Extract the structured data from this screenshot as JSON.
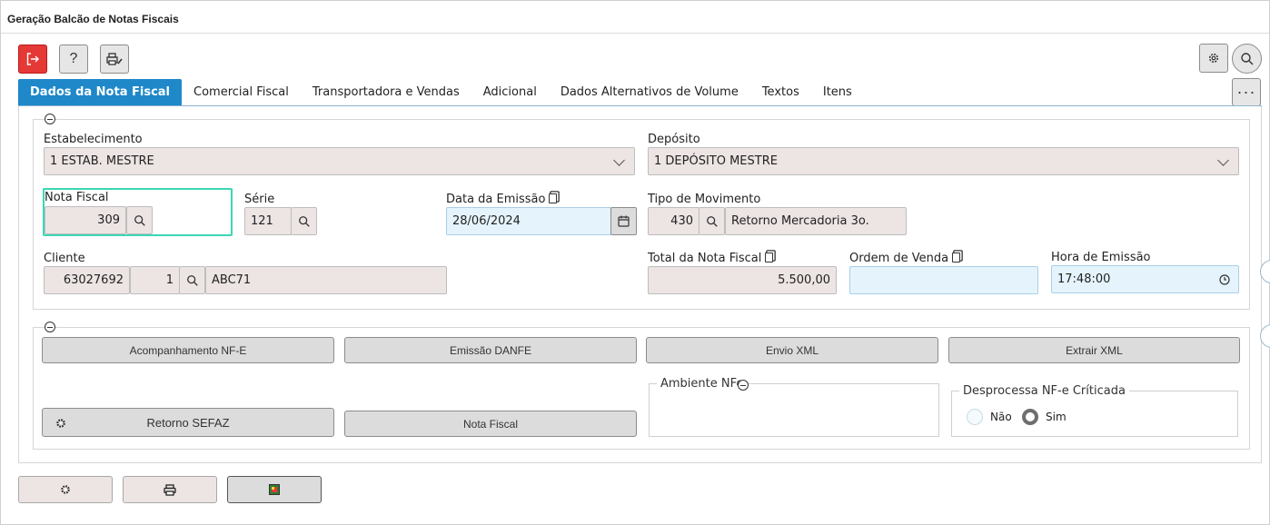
{
  "window": {
    "title": "Geração Balcão de Notas Fiscais"
  },
  "toolbar": {
    "exit_icon": "exit-icon",
    "help_label": "?",
    "print_tools_icon": "printer-wrench-icon",
    "config_icon": "gear-icon",
    "search_icon": "search-icon",
    "more_label": "···"
  },
  "tabs": [
    {
      "label": "Dados da Nota Fiscal"
    },
    {
      "label": "Comercial Fiscal"
    },
    {
      "label": "Transportadora e Vendas"
    },
    {
      "label": "Adicional"
    },
    {
      "label": "Dados Alternativos de Volume"
    },
    {
      "label": "Textos"
    },
    {
      "label": "Itens"
    }
  ],
  "form": {
    "estabelecimento": {
      "label": "Estabelecimento",
      "value": "1 ESTAB. MESTRE"
    },
    "deposito": {
      "label": "Depósito",
      "value": "1 DEPÓSITO MESTRE"
    },
    "nota_fiscal": {
      "label": "Nota Fiscal",
      "value": "309"
    },
    "serie": {
      "label": "Série",
      "value": "121"
    },
    "data_emissao": {
      "label": "Data da Emissão",
      "value": "28/06/2024"
    },
    "tipo_movimento": {
      "label": "Tipo de Movimento",
      "code": "430",
      "description": "Retorno Mercadoria 3o."
    },
    "cliente": {
      "label": "Cliente",
      "code": "63027692",
      "seq": "1",
      "name": "ABC71"
    },
    "total_nf": {
      "label": "Total da Nota Fiscal",
      "value": "5.500,00"
    },
    "ordem_venda": {
      "label": "Ordem de Venda",
      "value": ""
    },
    "hora_emissao": {
      "label": "Hora de Emissão",
      "value": "17:48:00"
    }
  },
  "actions": {
    "acompanhamento": "Acompanhamento NF-E",
    "emissao_danfe": "Emissão DANFE",
    "envio_xml": "Envio XML",
    "extrair_xml": "Extrair XML",
    "retorno_sefaz": "Retorno SEFAZ",
    "nota_fiscal": "Nota Fiscal"
  },
  "ambiente": {
    "legend": "Ambiente NFe"
  },
  "desprocessa": {
    "legend": "Desprocessa NF-e Críticada",
    "options": [
      "Não",
      "Sim"
    ],
    "selected": "Sim"
  },
  "footer": {
    "icons": [
      "gear-icon",
      "printer-icon",
      "export-icon"
    ]
  },
  "colors": {
    "accent": "#1e88c9",
    "exit": "#e53935",
    "field": "#ede4e4",
    "field_blue": "#e5f4fc",
    "focus": "#3dd6b5"
  }
}
